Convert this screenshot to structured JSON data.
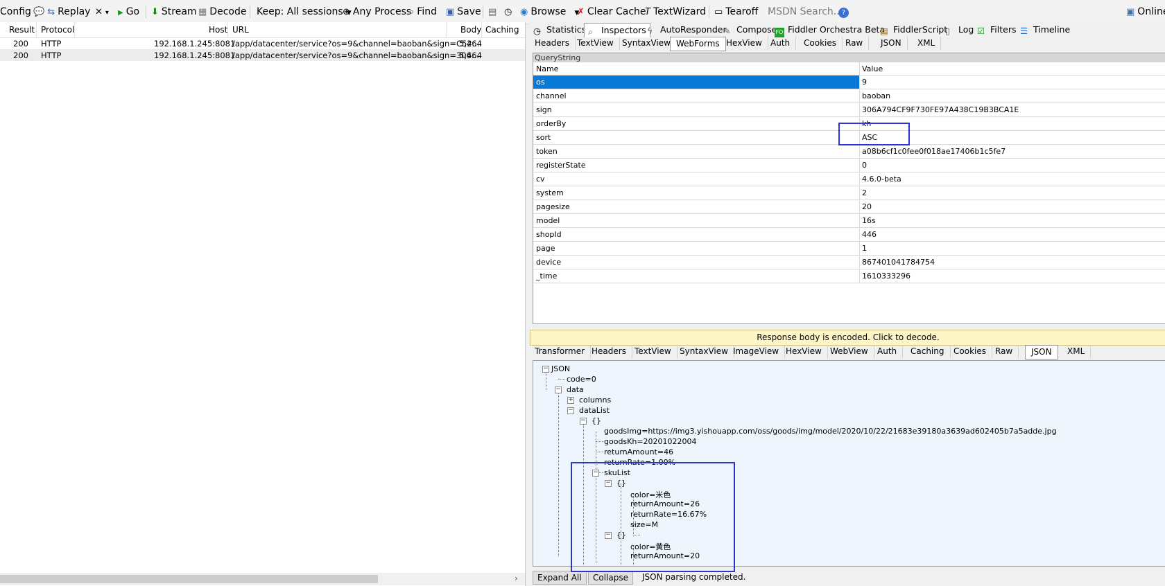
{
  "toolbar": {
    "config": "Config",
    "replay": "Replay",
    "remove_arrow": "▾",
    "go": "Go",
    "stream": "Stream",
    "decode": "Decode",
    "keep": "Keep: All sessions",
    "process": "Any Process",
    "find": "Find",
    "save": "Save",
    "browse": "Browse",
    "clear_cache": "Clear Cache",
    "textwizard": "TextWizard",
    "tearoff": "Tearoff",
    "msdn": "MSDN Search...",
    "online": "Online"
  },
  "sessions": {
    "headers": {
      "result": "Result",
      "protocol": "Protocol",
      "host": "Host",
      "url": "URL",
      "body": "Body",
      "caching": "Caching"
    },
    "rows": [
      {
        "result": "200",
        "protocol": "HTTP",
        "host": "192.168.1.245:8081",
        "url": "/app/datacenter/service?os=9&channel=baoban&sign=C52...",
        "body": "5,464"
      },
      {
        "result": "200",
        "protocol": "HTTP",
        "host": "192.168.1.245:8081",
        "url": "/app/datacenter/service?os=9&channel=baoban&sign=306...",
        "body": "5,464"
      }
    ]
  },
  "inspector_tabs": {
    "statistics": "Statistics",
    "inspectors": "Inspectors",
    "autoresponder": "AutoResponder",
    "composer": "Composer",
    "orchestra": "Fiddler Orchestra Beta",
    "orchestra_badge": "FO",
    "fiddlerscript": "FiddlerScript",
    "log": "Log",
    "filters": "Filters",
    "timeline": "Timeline"
  },
  "request_tabs": [
    "Headers",
    "TextView",
    "SyntaxView",
    "WebForms",
    "HexView",
    "Auth",
    "Cookies",
    "Raw",
    "JSON",
    "XML"
  ],
  "querystring": {
    "title": "QueryString",
    "col_name": "Name",
    "col_value": "Value",
    "rows": [
      {
        "name": "os",
        "value": "9"
      },
      {
        "name": "channel",
        "value": "baoban"
      },
      {
        "name": "sign",
        "value": "306A794CF9F730FE97A438C19B3BCA1E"
      },
      {
        "name": "orderBy",
        "value": "kh"
      },
      {
        "name": "sort",
        "value": "ASC"
      },
      {
        "name": "token",
        "value": "a08b6cf1c0fee0f018ae17406b1c5fe7"
      },
      {
        "name": "registerState",
        "value": "0"
      },
      {
        "name": "cv",
        "value": "4.6.0-beta"
      },
      {
        "name": "system",
        "value": "2"
      },
      {
        "name": "pagesize",
        "value": "20"
      },
      {
        "name": "model",
        "value": "16s"
      },
      {
        "name": "shopId",
        "value": "446"
      },
      {
        "name": "page",
        "value": "1"
      },
      {
        "name": "device",
        "value": "867401041784754"
      },
      {
        "name": "_time",
        "value": "1610333296"
      }
    ]
  },
  "decode_bar": "Response body is encoded. Click to decode.",
  "response_tabs": [
    "Transformer",
    "Headers",
    "TextView",
    "SyntaxView",
    "ImageView",
    "HexView",
    "WebView",
    "Auth",
    "Caching",
    "Cookies",
    "Raw",
    "JSON",
    "XML"
  ],
  "json_tree": {
    "root": "JSON",
    "code": "code=0",
    "data": "data",
    "columns": "columns",
    "datalist": "dataList",
    "obj": "{}",
    "goodsimg": "goodsImg=https://img3.yishouapp.com/oss/goods/img/model/2020/10/22/21683e39180a3639ad602405b7a5adde.jpg",
    "goodskh": "goodsKh=20201022004",
    "returnamount": "returnAmount=46",
    "returnrate": "returnRate=1.00%",
    "skulist": "skuList",
    "sku1_color": "color=米色",
    "sku1_amount": "returnAmount=26",
    "sku1_rate": "returnRate=16.67%",
    "sku1_size": "size=M",
    "sku2_color": "color=黄色",
    "sku2_amount": "returnAmount=20"
  },
  "bottom": {
    "expand_all": "Expand All",
    "collapse": "Collapse",
    "status": "JSON parsing completed."
  },
  "colors": {
    "highlight": "#2b35d6",
    "selection": "#0a78d7",
    "tree_bg": "#eef5fd",
    "decode_bg": "#fff6c7"
  }
}
